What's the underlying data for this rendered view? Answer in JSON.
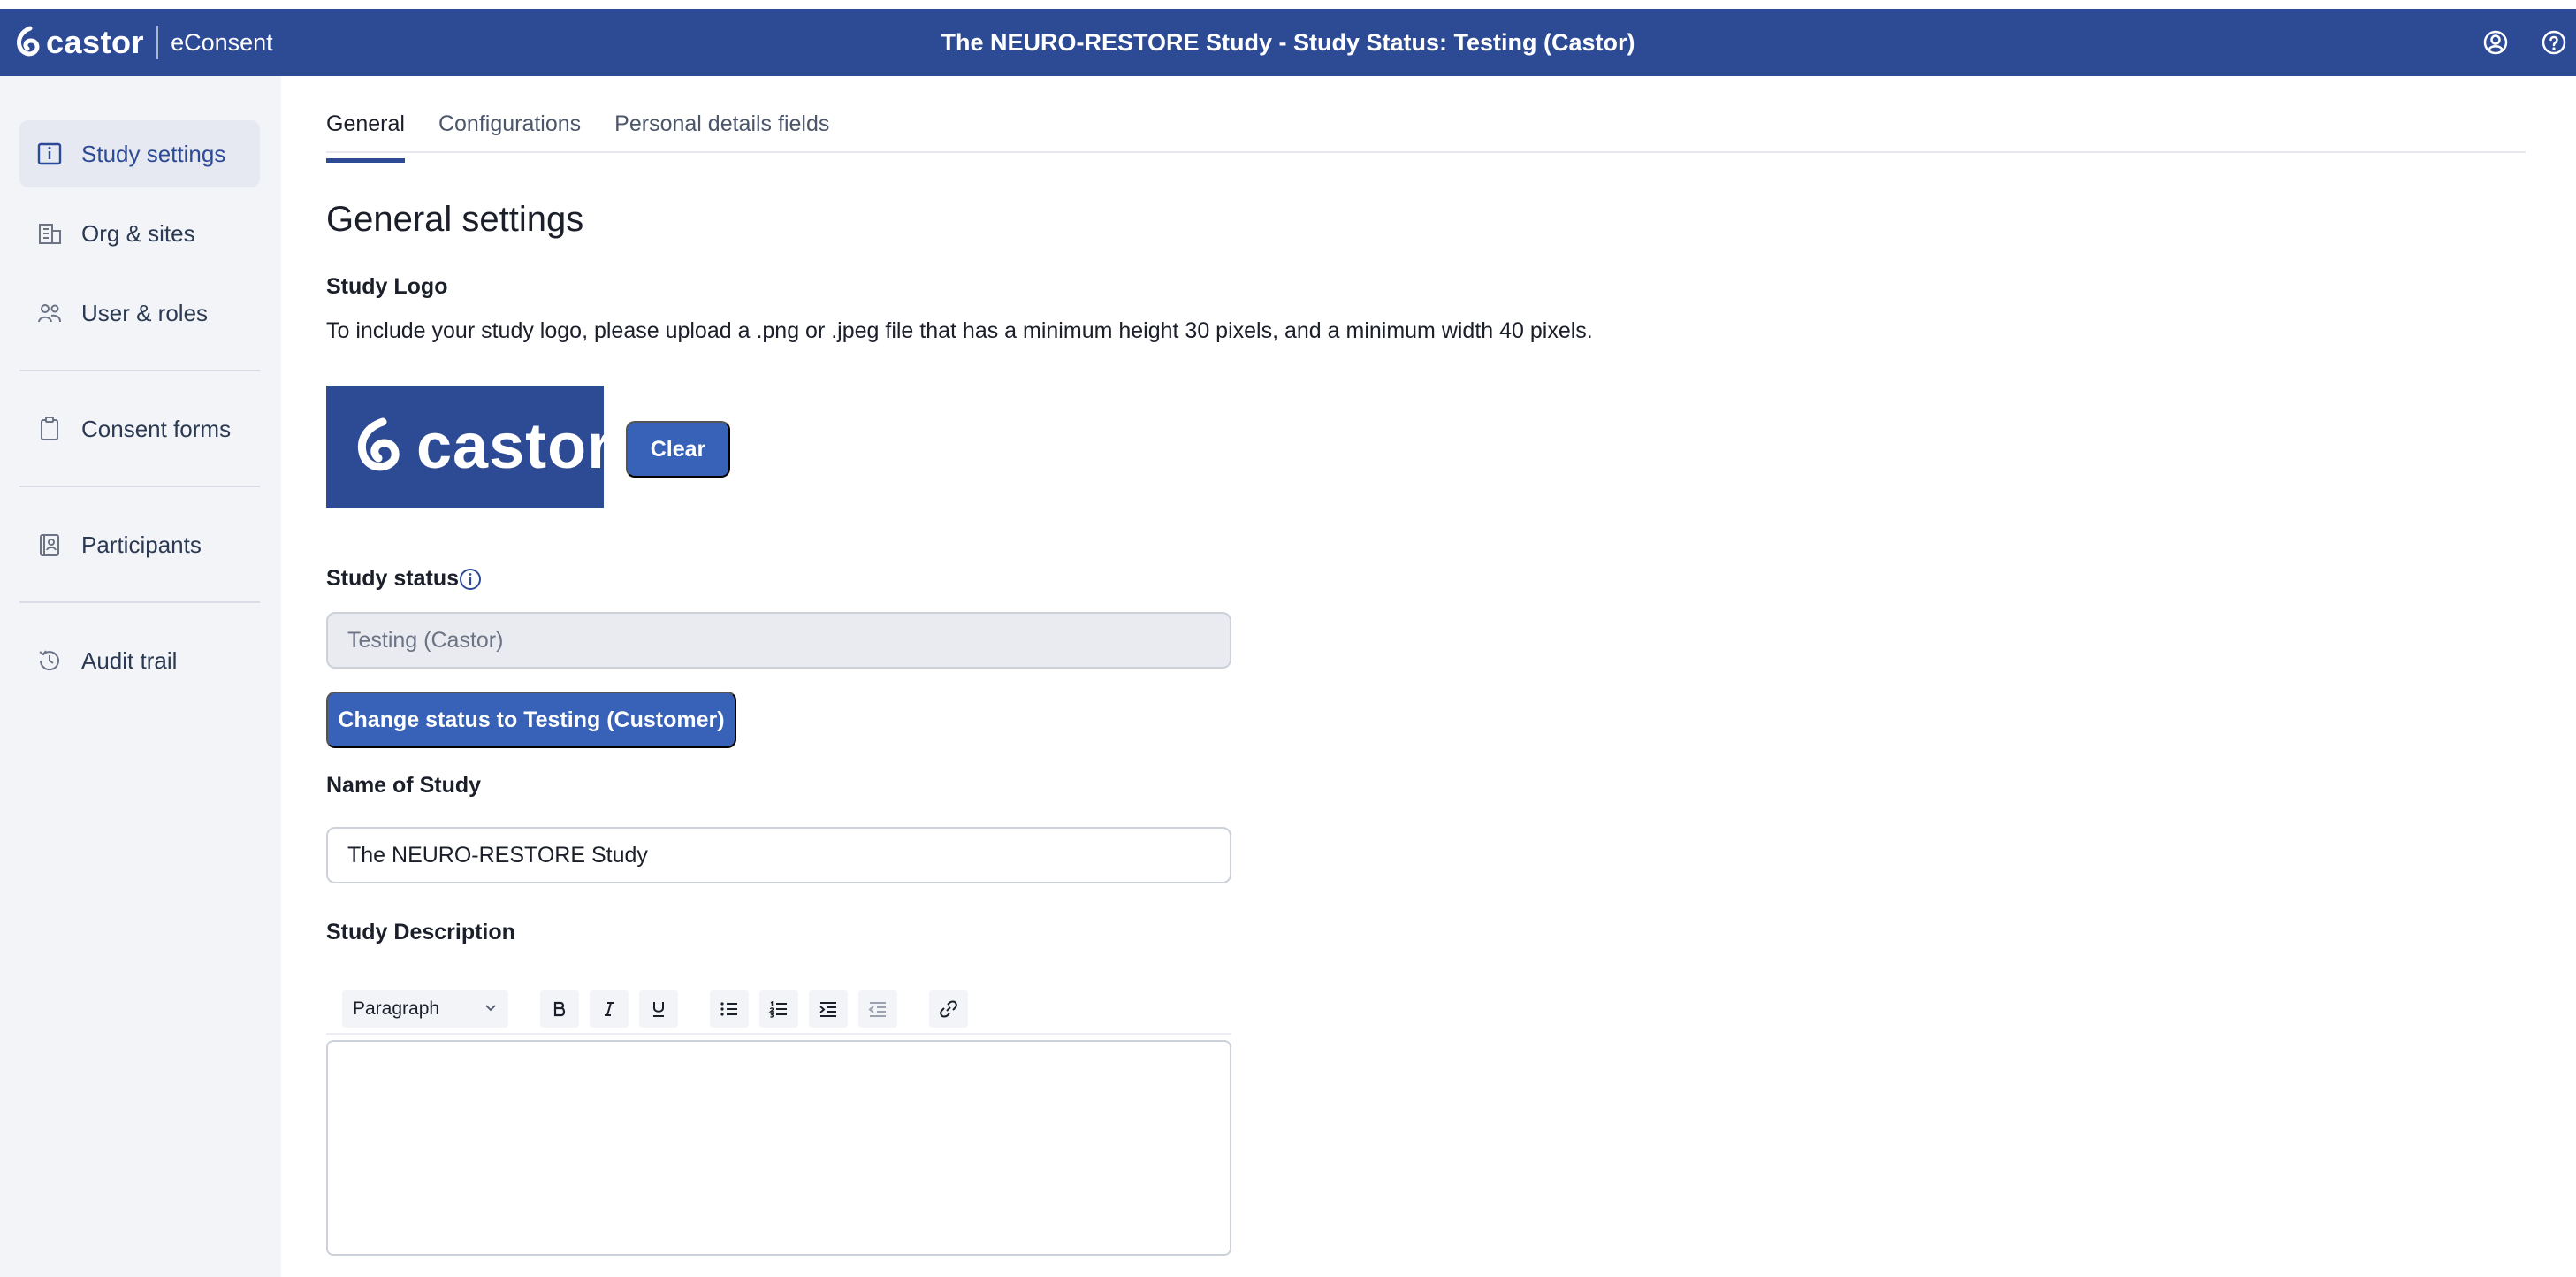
{
  "header": {
    "brand_name": "castor",
    "product_name": "eConsent",
    "title": "The NEURO-RESTORE Study  - Study Status: Testing (Castor)",
    "icons": [
      "account-icon",
      "help-icon"
    ]
  },
  "sidebar": {
    "items": [
      {
        "label": "Study settings",
        "icon": "info-icon",
        "active": true
      },
      {
        "label": "Org & sites",
        "icon": "building-icon"
      },
      {
        "label": "User & roles",
        "icon": "users-icon"
      },
      {
        "label": "Consent forms",
        "icon": "clipboard-icon"
      },
      {
        "label": "Participants",
        "icon": "contacts-icon"
      },
      {
        "label": "Audit trail",
        "icon": "history-icon"
      }
    ]
  },
  "tabs": [
    {
      "label": "General",
      "active": true
    },
    {
      "label": "Configurations"
    },
    {
      "label": "Personal details fields"
    }
  ],
  "main": {
    "page_title": "General settings",
    "study_logo": {
      "label": "Study Logo",
      "helper": "To include your study logo, please upload a .png or .jpeg file that has a minimum height 30 pixels, and a minimum width 40 pixels.",
      "logo_text": "castor",
      "clear_label": "Clear"
    },
    "study_status": {
      "label": "Study status",
      "value": "Testing (Castor)",
      "change_button": "Change status to Testing (Customer)"
    },
    "study_name": {
      "label": "Name of Study",
      "value": "The NEURO-RESTORE Study"
    },
    "study_description": {
      "label": "Study Description",
      "format_select": "Paragraph",
      "value": ""
    }
  },
  "colors": {
    "brand": "#2d4a95",
    "button": "#3861b8",
    "sidebar_bg": "#f3f4f8"
  }
}
